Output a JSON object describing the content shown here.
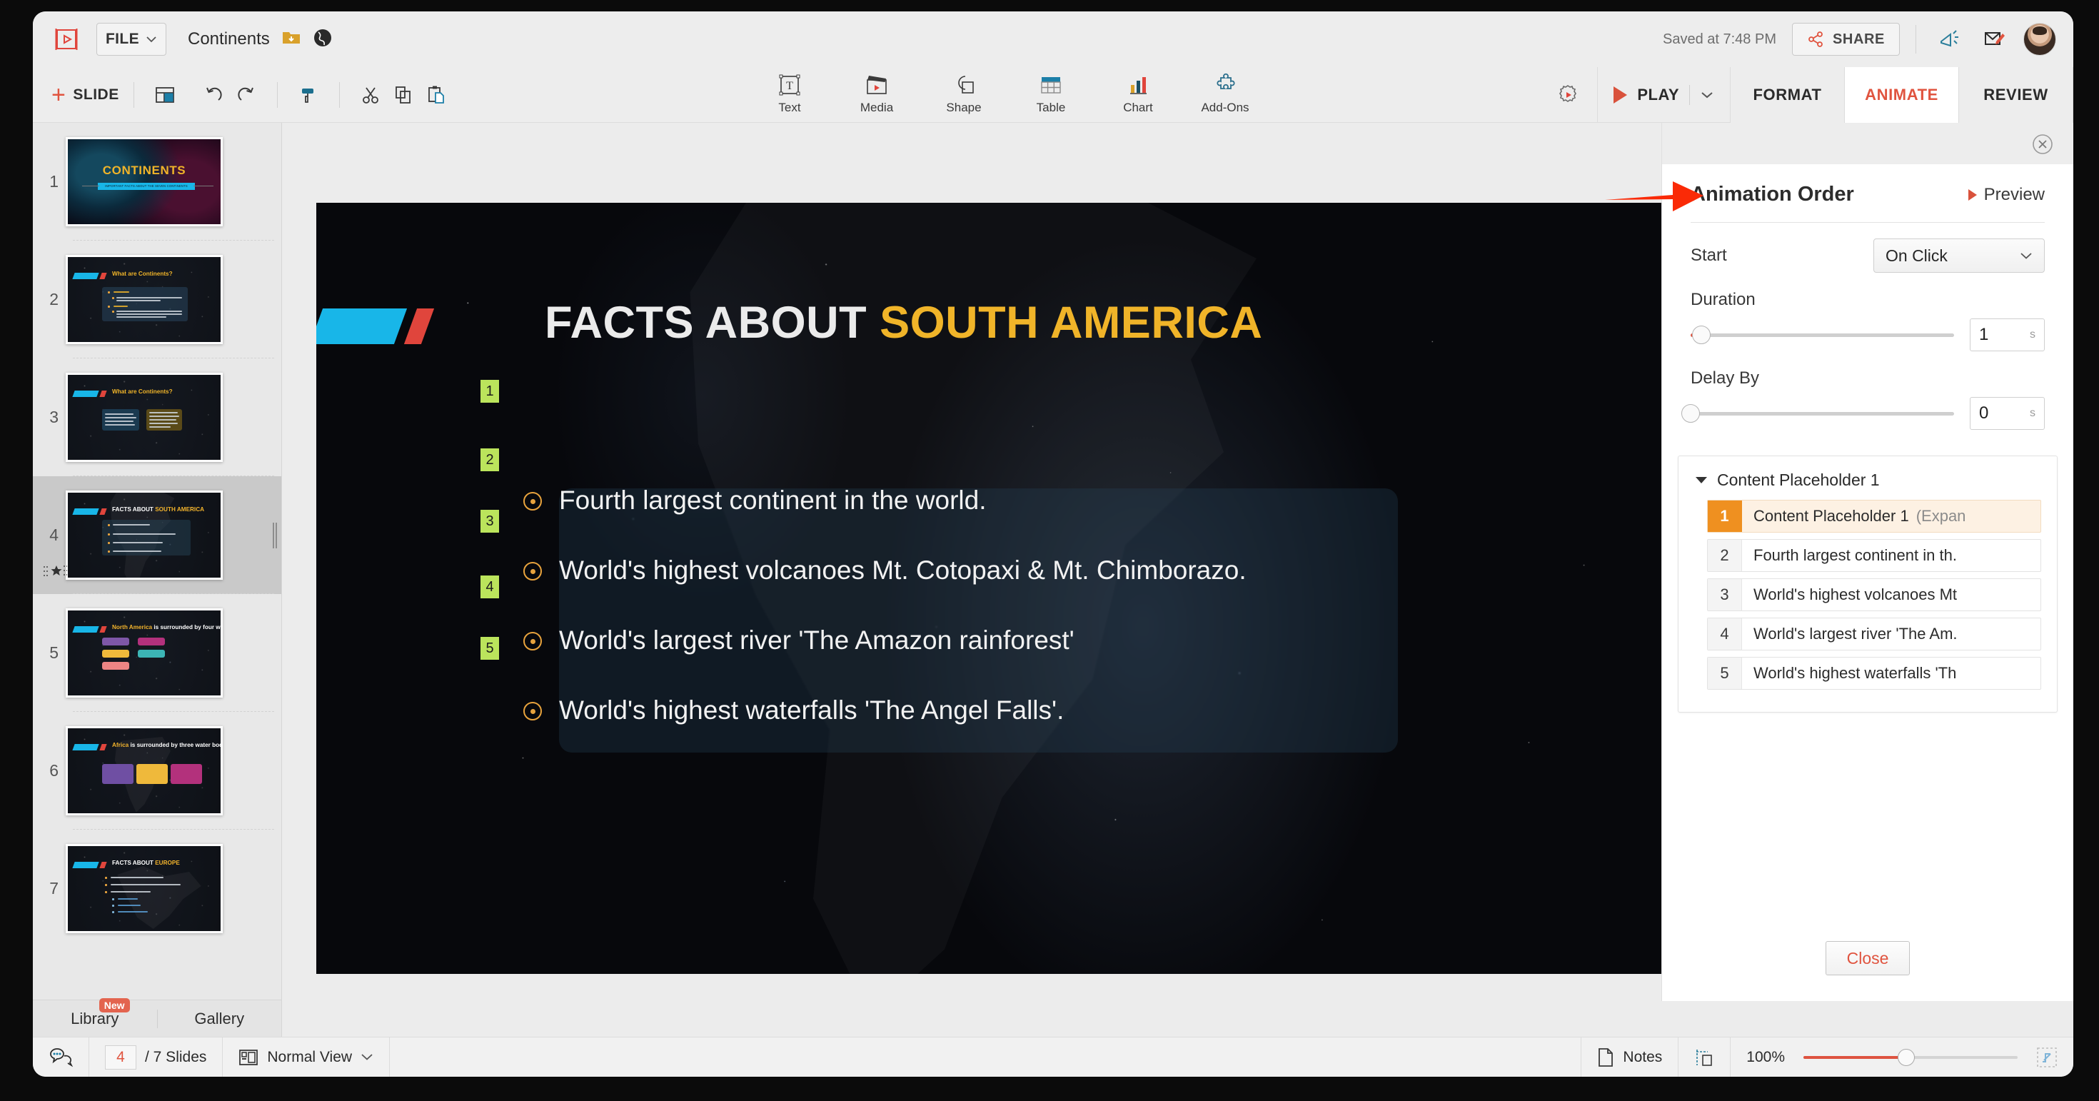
{
  "app": {
    "file_menu": "FILE",
    "document_title": "Continents",
    "saved_status": "Saved at 7:48 PM",
    "share_label": "SHARE"
  },
  "toolbar": {
    "add_slide_label": "SLIDE",
    "play_label": "PLAY",
    "insert_tools": [
      {
        "label": "Text",
        "icon": "text-icon"
      },
      {
        "label": "Media",
        "icon": "media-icon"
      },
      {
        "label": "Shape",
        "icon": "shape-icon"
      },
      {
        "label": "Table",
        "icon": "table-icon"
      },
      {
        "label": "Chart",
        "icon": "chart-icon"
      },
      {
        "label": "Add-Ons",
        "icon": "addons-icon"
      }
    ],
    "ribbon_tabs": [
      {
        "label": "FORMAT",
        "active": false
      },
      {
        "label": "ANIMATE",
        "active": true
      },
      {
        "label": "REVIEW",
        "active": false
      }
    ]
  },
  "thumbnails": {
    "slides": [
      {
        "number": "1",
        "title": "CONTINENTS",
        "subtitle": "IMPORTANT FACTS ABOUT THE SEVEN CONTINENTS"
      },
      {
        "number": "2",
        "title": "What are Continents?",
        "title_highlight": ""
      },
      {
        "number": "3",
        "title": "What are Continents?",
        "title_highlight": ""
      },
      {
        "number": "4",
        "title": "FACTS ABOUT ",
        "title_highlight": "SOUTH AMERICA"
      },
      {
        "number": "5",
        "title": " is surrounded by four water bodies:",
        "title_highlight": "North America"
      },
      {
        "number": "6",
        "title": " is surrounded by three water bodies",
        "title_highlight": "Africa"
      },
      {
        "number": "7",
        "title": "FACTS ABOUT ",
        "title_highlight": "EUROPE"
      }
    ],
    "selected": "4",
    "tabs": [
      {
        "label": "Library",
        "badge": "New"
      },
      {
        "label": "Gallery",
        "badge": ""
      }
    ]
  },
  "slide": {
    "title_main": "FACTS ABOUT ",
    "title_highlight": "SOUTH AMERICA",
    "bullets": [
      {
        "anim_number": "2",
        "text": "Fourth largest continent in the world."
      },
      {
        "anim_number": "3",
        "text": "World's highest volcanoes Mt. Cotopaxi & Mt. Chimborazo."
      },
      {
        "anim_number": "4",
        "text": "World's largest river 'The Amazon rainforest'"
      },
      {
        "anim_number": "5",
        "text": "World's highest waterfalls 'The Angel Falls'."
      }
    ],
    "placeholder_anim_number": "1"
  },
  "animation_panel": {
    "heading": "Animation Order",
    "preview_label": "Preview",
    "start_label": "Start",
    "start_value": "On Click",
    "duration_label": "Duration",
    "duration_value": "1",
    "duration_unit": "s",
    "duration_percent": 4,
    "delay_label": "Delay By",
    "delay_value": "0",
    "delay_unit": "s",
    "delay_percent": 0,
    "group_label": "Content Placeholder 1",
    "items": [
      {
        "index": "1",
        "label": "Content Placeholder 1",
        "sub": "(Expan",
        "active": true
      },
      {
        "index": "2",
        "label": "Fourth largest continent in th.",
        "sub": "",
        "active": false
      },
      {
        "index": "3",
        "label": "World's highest volcanoes Mt",
        "sub": "",
        "active": false
      },
      {
        "index": "4",
        "label": "World's largest river 'The Am.",
        "sub": "",
        "active": false
      },
      {
        "index": "5",
        "label": "World's highest waterfalls 'Th",
        "sub": "",
        "active": false
      }
    ],
    "close_label": "Close"
  },
  "statusbar": {
    "current_slide": "4",
    "slide_count_label": "/ 7 Slides",
    "view_mode": "Normal View",
    "notes_label": "Notes",
    "zoom_label": "100%",
    "zoom_percent": 48
  },
  "colors": {
    "accent_red": "#e0543f",
    "accent_orange": "#ef9020",
    "slide_yellow": "#f0b429",
    "slide_cyan": "#18b6e8",
    "anim_badge_green": "#bbe45c"
  }
}
